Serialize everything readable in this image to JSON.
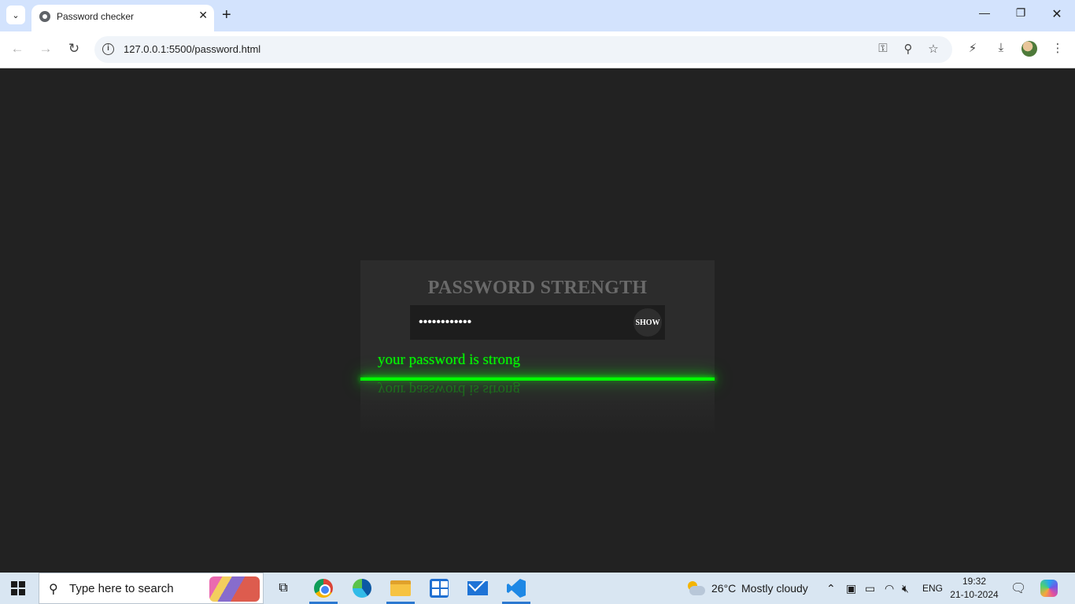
{
  "browser": {
    "tab_title": "Password checker",
    "url": "127.0.0.1:5500/password.html",
    "new_tab_label": "+",
    "tab_close_label": "✕"
  },
  "page": {
    "heading": "PASSWORD STRENGTH",
    "password_value": "••••••••••••",
    "show_label": "SHOW",
    "strength_message": "your password is strong",
    "strength_color": "#00ff00"
  },
  "taskbar": {
    "search_placeholder": "Type here to search",
    "weather_temp": "26°C",
    "weather_desc": "Mostly cloudy",
    "language": "ENG",
    "time": "19:32",
    "date": "21-10-2024"
  }
}
